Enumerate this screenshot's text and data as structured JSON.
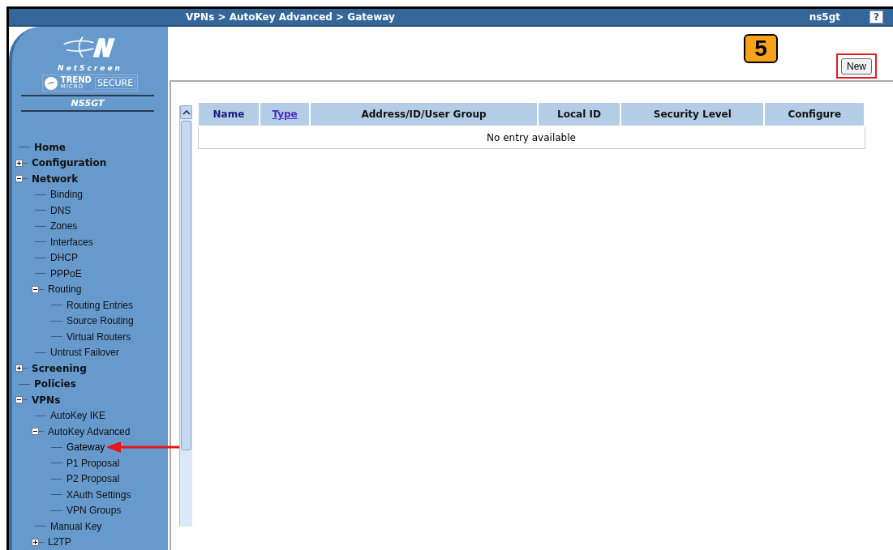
{
  "header": {
    "breadcrumb": "VPNs > AutoKey Advanced > Gateway",
    "device": "ns5gt",
    "help": "?"
  },
  "logo": {
    "brand": "NetScreen",
    "partner": "TREND",
    "partner_sub": "MICRO",
    "secure": "SECURE",
    "model": "NS5GT"
  },
  "sidebar": {
    "items": [
      {
        "label": "Home",
        "selected": false
      },
      {
        "label": "Configuration",
        "expanded": false,
        "selected": false
      },
      {
        "label": "Network",
        "expanded": true,
        "selected": false,
        "children": [
          {
            "label": "Binding",
            "selected": false
          },
          {
            "label": "DNS",
            "selected": false
          },
          {
            "label": "Zones",
            "selected": false
          },
          {
            "label": "Interfaces",
            "selected": false
          },
          {
            "label": "DHCP",
            "selected": false
          },
          {
            "label": "PPPoE",
            "selected": false
          },
          {
            "label": "Routing",
            "expanded": true,
            "selected": false,
            "children": [
              {
                "label": "Routing Entries",
                "selected": false
              },
              {
                "label": "Source Routing",
                "selected": false
              },
              {
                "label": "Virtual Routers",
                "selected": false
              }
            ]
          },
          {
            "label": "Untrust Failover",
            "selected": false
          }
        ]
      },
      {
        "label": "Screening",
        "expanded": false,
        "selected": false
      },
      {
        "label": "Policies",
        "selected": false
      },
      {
        "label": "VPNs",
        "expanded": true,
        "selected": false,
        "children": [
          {
            "label": "AutoKey IKE",
            "selected": false
          },
          {
            "label": "AutoKey Advanced",
            "expanded": true,
            "selected": false,
            "children": [
              {
                "label": "Gateway",
                "selected": true
              },
              {
                "label": "P1 Proposal",
                "selected": false
              },
              {
                "label": "P2 Proposal",
                "selected": false
              },
              {
                "label": "XAuth Settings",
                "selected": false
              },
              {
                "label": "VPN Groups",
                "selected": false
              }
            ]
          },
          {
            "label": "Manual Key",
            "selected": false
          },
          {
            "label": "L2TP",
            "expanded": false,
            "selected": false
          }
        ]
      }
    ]
  },
  "step_badge": "5",
  "new_button": "New",
  "table": {
    "columns": [
      {
        "label": "Name",
        "link": false
      },
      {
        "label": "Type",
        "link": true
      },
      {
        "label": "Address/ID/User Group",
        "link": false
      },
      {
        "label": "Local ID",
        "link": false
      },
      {
        "label": "Security Level",
        "link": false
      },
      {
        "label": "Configure",
        "link": false
      }
    ],
    "empty_message": "No entry available"
  }
}
